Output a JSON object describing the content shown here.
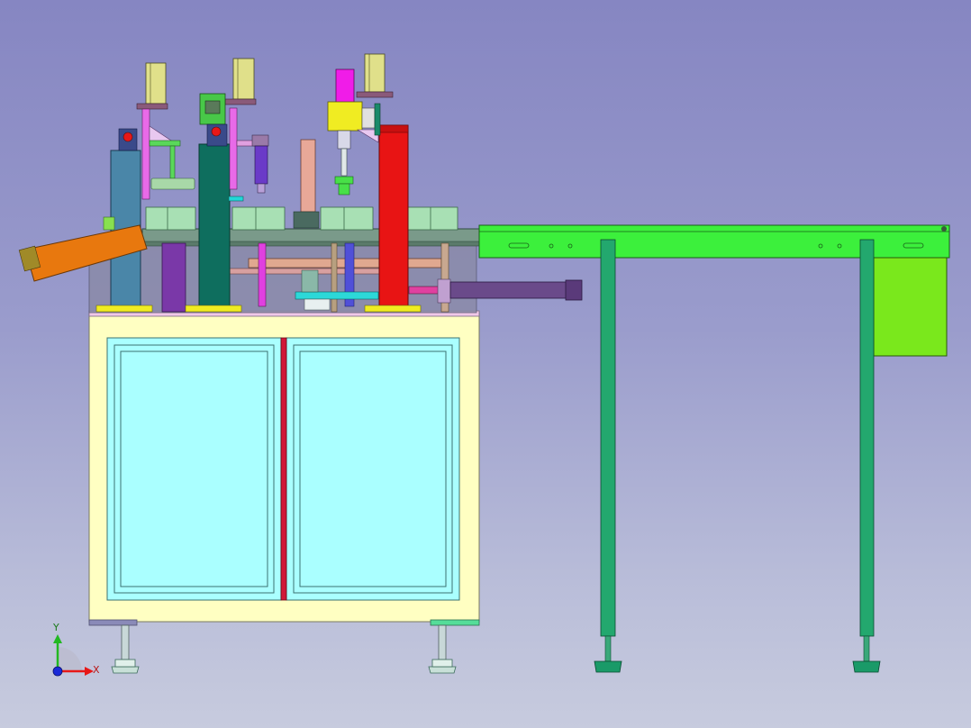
{
  "viewport": {
    "background_top": "#8686c2",
    "background_bottom": "#c7cbde"
  },
  "triad": {
    "x_label": "X",
    "y_label": "Y",
    "x_color": "#e81818",
    "y_color": "#22b822",
    "z_color": "#1a2ad8"
  },
  "colors": {
    "cabinet_frame": "#ffffc2",
    "cabinet_glass": "#aaffff",
    "door_divider": "#d01838",
    "conveyor_belt": "#3cf03c",
    "conveyor_legs": "#23a86e",
    "conveyor_bin": "#7ae81c",
    "red_column": "#e81414",
    "blue_column": "#4a86a8",
    "teal_column": "#0e6e5e",
    "orange_chute": "#e8780e",
    "yellow_block": "#f0ec22",
    "magenta_cylinder": "#f01ce8",
    "feeder_tubes": "#a8d8b4"
  }
}
